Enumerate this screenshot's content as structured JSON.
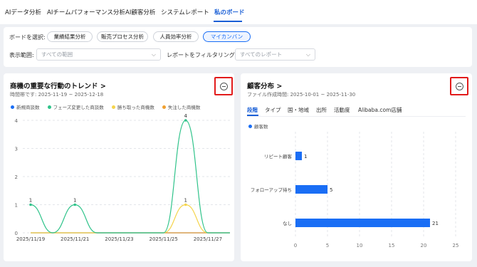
{
  "nav": {
    "tabs": [
      {
        "label": "AIデータ分析"
      },
      {
        "label": "AIチームパフォーマンス分析"
      },
      {
        "label": "AI顧客分析"
      },
      {
        "label": "システムレポート"
      },
      {
        "label": "私のボード"
      }
    ]
  },
  "filters": {
    "board_label": "ボードを選択:",
    "boards": [
      {
        "label": "業績結果分析"
      },
      {
        "label": "販売プロセス分析"
      },
      {
        "label": "人員効率分析"
      },
      {
        "label": "マイカンバン"
      }
    ],
    "range_label": "表示範囲:",
    "range_value": "すべての範囲",
    "report_filter_label": "レポートをフィルタリング:",
    "report_filter_placeholder": "すべてのレポート"
  },
  "left_card": {
    "title": "商機の重要な行動のトレンド",
    "title_arrow": ">",
    "subtitle": "時間帯です: 2025-11-19 ~ 2025-12-18"
  },
  "right_card": {
    "title": "顧客分布",
    "title_arrow": ">",
    "subtitle": "ファイル作成時間: 2025-10-01 ~ 2025-11-30",
    "tabs": [
      {
        "label": "段階"
      },
      {
        "label": "タイプ"
      },
      {
        "label": "国・地域"
      },
      {
        "label": "出所"
      },
      {
        "label": "活動度"
      },
      {
        "label": "Alibaba.com店舗"
      }
    ]
  },
  "colors": {
    "accent": "#1a5fd6",
    "highlight_box": "#e21b1b",
    "series_blue": "#1a6ef5",
    "series_green": "#2fc38a",
    "series_yellow": "#f5d44c",
    "series_orange": "#f0a030"
  },
  "icons": {
    "collapse": "minus-circle-icon",
    "title_link": "chevron-right-icon",
    "select_chevron": "chevron-down-icon"
  },
  "chart_data": [
    {
      "type": "line",
      "smooth": true,
      "x": [
        "2025/11/19",
        "2025/11/20",
        "2025/11/21",
        "2025/11/22",
        "2025/11/23",
        "2025/11/24",
        "2025/11/25",
        "2025/11/26",
        "2025/11/27",
        "2025/11/28"
      ],
      "xtick_labels": [
        "2025/11/19",
        "2025/11/21",
        "2025/11/23",
        "2025/11/25",
        "2025/11/27"
      ],
      "ylim": [
        0,
        4
      ],
      "yticks": [
        0,
        1,
        2,
        3,
        4
      ],
      "grid": true,
      "legend": "top-left",
      "series": [
        {
          "name": "新規商談数",
          "color": "#1a6ef5",
          "values": [
            0,
            0,
            0,
            0,
            0,
            0,
            0,
            0,
            0,
            0
          ]
        },
        {
          "name": "フェーズ変更した商談数",
          "color": "#2fc38a",
          "values": [
            1,
            0,
            1,
            0,
            0,
            0,
            0,
            4,
            0,
            0
          ]
        },
        {
          "name": "勝ち取った商機数",
          "color": "#f5d44c",
          "values": [
            0,
            0,
            0,
            0,
            0,
            0,
            0,
            1,
            0,
            0
          ]
        },
        {
          "name": "失注した商機数",
          "color": "#f0a030",
          "values": [
            0,
            0,
            0,
            0,
            0,
            0,
            0,
            0,
            0,
            0
          ]
        }
      ],
      "data_labels": [
        {
          "x": "2025/11/19",
          "value": 1
        },
        {
          "x": "2025/11/21",
          "value": 1
        },
        {
          "x": "2025/11/26",
          "value": 4
        },
        {
          "x": "2025/11/26",
          "value": 1
        }
      ]
    },
    {
      "type": "bar",
      "orientation": "horizontal",
      "categories": [
        "リピート顧客",
        "フォローアップ待ち",
        "なし"
      ],
      "series": [
        {
          "name": "顧客数",
          "color": "#1a6ef5",
          "values": [
            1,
            5,
            21
          ]
        }
      ],
      "xlim": [
        0,
        25
      ],
      "xticks": [
        0,
        5,
        10,
        15,
        20,
        25
      ],
      "grid": true,
      "legend": "top-left"
    }
  ]
}
